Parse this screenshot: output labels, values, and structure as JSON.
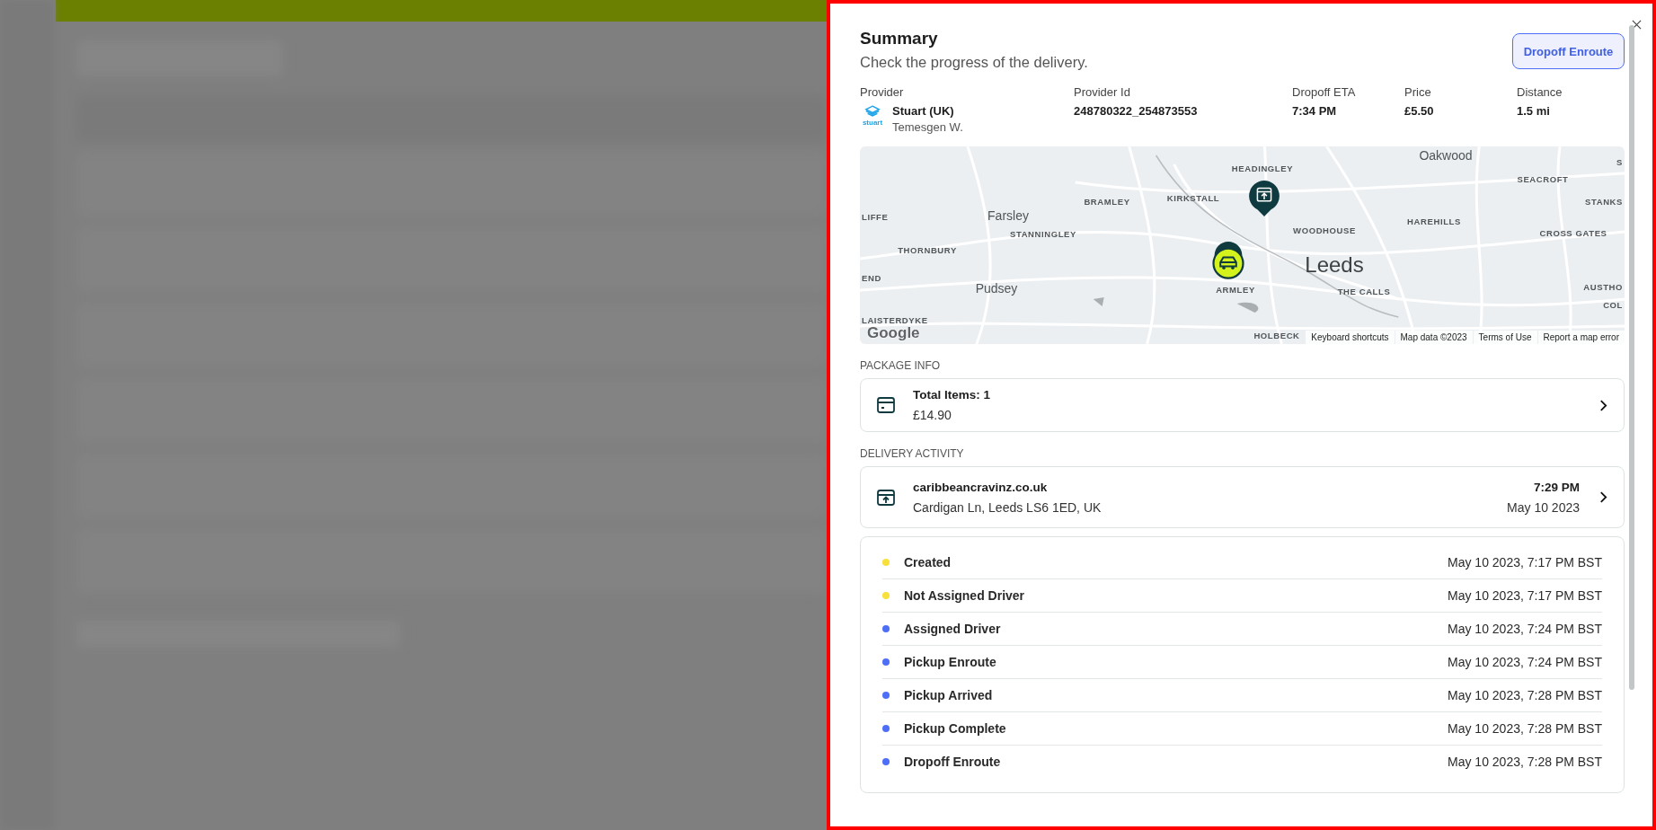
{
  "summary": {
    "title": "Summary",
    "subtitle": "Check the progress of the delivery.",
    "status_button": "Dropoff Enroute"
  },
  "details": [
    {
      "label": "Provider",
      "value": "Stuart (UK)",
      "subvalue": "Temesgen W.",
      "logo_text": "stuart"
    },
    {
      "label": "Provider Id",
      "value": "248780322_254873553"
    },
    {
      "label": "Dropoff ETA",
      "value": "7:34 PM"
    },
    {
      "label": "Price",
      "value": "£5.50"
    },
    {
      "label": "Distance",
      "value": "1.5 mi"
    }
  ],
  "map": {
    "labels": [
      "Oakwood",
      "S",
      "HEADINGLEY",
      "SEACROFT",
      "BRAMLEY",
      "KIRKSTALL",
      "STANKS",
      "LIFFE",
      "Farsley",
      "HAREHILLS",
      "STANNINGLEY",
      "WOODHOUSE",
      "CROSS GATES",
      "THORNBURY",
      "Leeds",
      "END",
      "Pudsey",
      "ARMLEY",
      "THE CALLS",
      "AUSTHO",
      "COL",
      "LAISTERDYKE",
      "HOLBECK"
    ],
    "logo": "Google",
    "attribution": [
      "Keyboard shortcuts",
      "Map data ©2023",
      "Terms of Use",
      "Report a map error"
    ]
  },
  "package_info": {
    "heading": "PACKAGE INFO",
    "title": "Total Items: 1",
    "amount": "£14.90"
  },
  "delivery_activity": {
    "heading": "DELIVERY ACTIVITY",
    "name": "caribbeancravinz.co.uk",
    "address": "Cardigan Ln, Leeds LS6 1ED, UK",
    "time": "7:29 PM",
    "date": "May 10 2023"
  },
  "timeline": [
    {
      "status": "Created",
      "timestamp": "May 10 2023, 7:17 PM BST",
      "color": "#f7e03c"
    },
    {
      "status": "Not Assigned Driver",
      "timestamp": "May 10 2023, 7:17 PM BST",
      "color": "#f7e03c"
    },
    {
      "status": "Assigned Driver",
      "timestamp": "May 10 2023, 7:24 PM BST",
      "color": "#4f6ef7"
    },
    {
      "status": "Pickup Enroute",
      "timestamp": "May 10 2023, 7:24 PM BST",
      "color": "#4f6ef7"
    },
    {
      "status": "Pickup Arrived",
      "timestamp": "May 10 2023, 7:28 PM BST",
      "color": "#4f6ef7"
    },
    {
      "status": "Pickup Complete",
      "timestamp": "May 10 2023, 7:28 PM BST",
      "color": "#4f6ef7"
    },
    {
      "status": "Dropoff Enroute",
      "timestamp": "May 10 2023, 7:28 PM BST",
      "color": "#4f6ef7"
    }
  ]
}
